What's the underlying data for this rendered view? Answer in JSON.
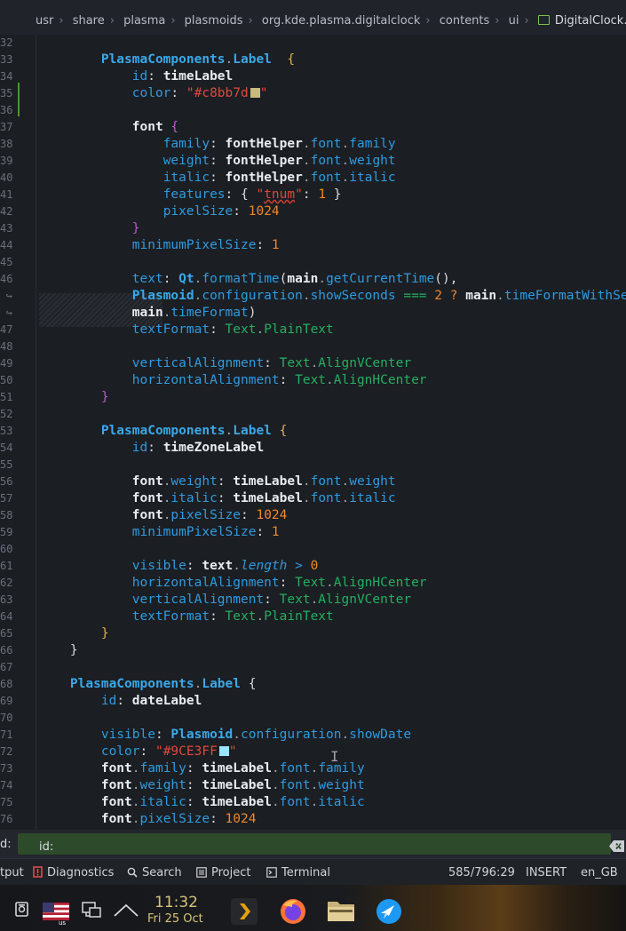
{
  "breadcrumb": {
    "segments": [
      "usr",
      "share",
      "plasma",
      "plasmoids",
      "org.kde.plasma.digitalclock",
      "contents",
      "ui"
    ],
    "file": "DigitalClock.qml"
  },
  "editor": {
    "line_numbers": [
      "32",
      "33",
      "34",
      "35",
      "36",
      "37",
      "38",
      "39",
      "40",
      "41",
      "42",
      "43",
      "44",
      "45",
      "46",
      "↪",
      "↪",
      "47",
      "48",
      "49",
      "50",
      "51",
      "52",
      "53",
      "54",
      "55",
      "56",
      "57",
      "58",
      "59",
      "60",
      "61",
      "62",
      "63",
      "64",
      "65",
      "66",
      "67",
      "68",
      "69",
      "70",
      "71",
      "72",
      "73",
      "74",
      "75",
      "76"
    ],
    "lines": [
      [],
      [
        [
          "s",
          "        "
        ],
        [
          "type",
          "PlasmaComponents"
        ],
        [
          "dot",
          "."
        ],
        [
          "type",
          "Label"
        ],
        [
          "s",
          "  "
        ],
        [
          "brace",
          "{"
        ]
      ],
      [
        [
          "s",
          "            "
        ],
        [
          "prop",
          "id"
        ],
        [
          "s",
          ": "
        ],
        [
          "id",
          "timeLabel"
        ]
      ],
      [
        [
          "s",
          "            "
        ],
        [
          "prop",
          "color"
        ],
        [
          "s",
          ": "
        ],
        [
          "str",
          "\"#c8bb7d"
        ],
        [
          "swatch",
          "#c8bb7d"
        ],
        [
          "str",
          "\""
        ]
      ],
      [],
      [
        [
          "s",
          "            "
        ],
        [
          "id",
          "font"
        ],
        [
          "s",
          " "
        ],
        [
          "brace2",
          "{"
        ]
      ],
      [
        [
          "s",
          "                "
        ],
        [
          "prop",
          "family"
        ],
        [
          "s",
          ": "
        ],
        [
          "id",
          "fontHelper"
        ],
        [
          "dot",
          "."
        ],
        [
          "prop",
          "font"
        ],
        [
          "dot",
          "."
        ],
        [
          "prop",
          "family"
        ]
      ],
      [
        [
          "s",
          "                "
        ],
        [
          "prop",
          "weight"
        ],
        [
          "s",
          ": "
        ],
        [
          "id",
          "fontHelper"
        ],
        [
          "dot",
          "."
        ],
        [
          "prop",
          "font"
        ],
        [
          "dot",
          "."
        ],
        [
          "prop",
          "weight"
        ]
      ],
      [
        [
          "s",
          "                "
        ],
        [
          "prop",
          "italic"
        ],
        [
          "s",
          ": "
        ],
        [
          "id",
          "fontHelper"
        ],
        [
          "dot",
          "."
        ],
        [
          "prop",
          "font"
        ],
        [
          "dot",
          "."
        ],
        [
          "prop",
          "italic"
        ]
      ],
      [
        [
          "s",
          "                "
        ],
        [
          "prop",
          "features"
        ],
        [
          "s",
          ": { "
        ],
        [
          "str",
          "\""
        ],
        [
          "strsq",
          "tnum"
        ],
        [
          "str",
          "\""
        ],
        [
          "s",
          ": "
        ],
        [
          "num",
          "1"
        ],
        [
          "s",
          " }"
        ]
      ],
      [
        [
          "s",
          "                "
        ],
        [
          "prop",
          "pixelSize"
        ],
        [
          "s",
          ": "
        ],
        [
          "num",
          "1024"
        ]
      ],
      [
        [
          "s",
          "            "
        ],
        [
          "brace2",
          "}"
        ]
      ],
      [
        [
          "s",
          "            "
        ],
        [
          "prop",
          "minimumPixelSize"
        ],
        [
          "s",
          ": "
        ],
        [
          "num",
          "1"
        ]
      ],
      [],
      [
        [
          "s",
          "            "
        ],
        [
          "prop",
          "text"
        ],
        [
          "s",
          ": "
        ],
        [
          "type",
          "Qt"
        ],
        [
          "dot",
          "."
        ],
        [
          "prop",
          "formatTime"
        ],
        [
          "s",
          "("
        ],
        [
          "id",
          "main"
        ],
        [
          "dot",
          "."
        ],
        [
          "prop",
          "getCurrentTime"
        ],
        [
          "s",
          "(),"
        ]
      ],
      [
        [
          "s",
          "            "
        ],
        [
          "type",
          "Plasmoid"
        ],
        [
          "dot",
          "."
        ],
        [
          "prop",
          "configuration"
        ],
        [
          "dot",
          "."
        ],
        [
          "prop",
          "showSeconds"
        ],
        [
          "s",
          " "
        ],
        [
          "enum",
          "==="
        ],
        [
          "s",
          " "
        ],
        [
          "num",
          "2"
        ],
        [
          "s",
          " "
        ],
        [
          "num",
          "?"
        ],
        [
          "s",
          " "
        ],
        [
          "id",
          "main"
        ],
        [
          "dot",
          "."
        ],
        [
          "prop",
          "timeFormatWithSeconds"
        ]
      ],
      [
        [
          "s",
          "            "
        ],
        [
          "id",
          "main"
        ],
        [
          "dot",
          "."
        ],
        [
          "prop",
          "timeFormat"
        ],
        [
          "s",
          ")"
        ]
      ],
      [
        [
          "s",
          "            "
        ],
        [
          "prop",
          "textFormat"
        ],
        [
          "s",
          ": "
        ],
        [
          "enum",
          "Text"
        ],
        [
          "dot",
          "."
        ],
        [
          "enum",
          "PlainText"
        ]
      ],
      [],
      [
        [
          "s",
          "            "
        ],
        [
          "prop",
          "verticalAlignment"
        ],
        [
          "s",
          ": "
        ],
        [
          "enum",
          "Text"
        ],
        [
          "dot",
          "."
        ],
        [
          "enum",
          "AlignVCenter"
        ]
      ],
      [
        [
          "s",
          "            "
        ],
        [
          "prop",
          "horizontalAlignment"
        ],
        [
          "s",
          ": "
        ],
        [
          "enum",
          "Text"
        ],
        [
          "dot",
          "."
        ],
        [
          "enum",
          "AlignHCenter"
        ]
      ],
      [
        [
          "s",
          "        "
        ],
        [
          "brace2",
          "}"
        ]
      ],
      [],
      [
        [
          "s",
          "        "
        ],
        [
          "type",
          "PlasmaComponents"
        ],
        [
          "dot",
          "."
        ],
        [
          "type",
          "Label"
        ],
        [
          "s",
          " "
        ],
        [
          "brace",
          "{"
        ]
      ],
      [
        [
          "s",
          "            "
        ],
        [
          "prop",
          "id"
        ],
        [
          "s",
          ": "
        ],
        [
          "id",
          "timeZoneLabel"
        ]
      ],
      [],
      [
        [
          "s",
          "            "
        ],
        [
          "id",
          "font"
        ],
        [
          "dot",
          "."
        ],
        [
          "prop",
          "weight"
        ],
        [
          "s",
          ": "
        ],
        [
          "id",
          "timeLabel"
        ],
        [
          "dot",
          "."
        ],
        [
          "prop",
          "font"
        ],
        [
          "dot",
          "."
        ],
        [
          "prop",
          "weight"
        ]
      ],
      [
        [
          "s",
          "            "
        ],
        [
          "id",
          "font"
        ],
        [
          "dot",
          "."
        ],
        [
          "prop",
          "italic"
        ],
        [
          "s",
          ": "
        ],
        [
          "id",
          "timeLabel"
        ],
        [
          "dot",
          "."
        ],
        [
          "prop",
          "font"
        ],
        [
          "dot",
          "."
        ],
        [
          "prop",
          "italic"
        ]
      ],
      [
        [
          "s",
          "            "
        ],
        [
          "id",
          "font"
        ],
        [
          "dot",
          "."
        ],
        [
          "prop",
          "pixelSize"
        ],
        [
          "s",
          ": "
        ],
        [
          "num",
          "1024"
        ]
      ],
      [
        [
          "s",
          "            "
        ],
        [
          "prop",
          "minimumPixelSize"
        ],
        [
          "s",
          ": "
        ],
        [
          "num",
          "1"
        ]
      ],
      [],
      [
        [
          "s",
          "            "
        ],
        [
          "prop",
          "visible"
        ],
        [
          "s",
          ": "
        ],
        [
          "id",
          "text"
        ],
        [
          "dot",
          "."
        ],
        [
          "ital",
          "length"
        ],
        [
          "s",
          " "
        ],
        [
          "prop",
          ">"
        ],
        [
          "s",
          " "
        ],
        [
          "num",
          "0"
        ]
      ],
      [
        [
          "s",
          "            "
        ],
        [
          "prop",
          "horizontalAlignment"
        ],
        [
          "s",
          ": "
        ],
        [
          "enum",
          "Text"
        ],
        [
          "dot",
          "."
        ],
        [
          "enum",
          "AlignHCenter"
        ]
      ],
      [
        [
          "s",
          "            "
        ],
        [
          "prop",
          "verticalAlignment"
        ],
        [
          "s",
          ": "
        ],
        [
          "enum",
          "Text"
        ],
        [
          "dot",
          "."
        ],
        [
          "enum",
          "AlignVCenter"
        ]
      ],
      [
        [
          "s",
          "            "
        ],
        [
          "prop",
          "textFormat"
        ],
        [
          "s",
          ": "
        ],
        [
          "enum",
          "Text"
        ],
        [
          "dot",
          "."
        ],
        [
          "enum",
          "PlainText"
        ]
      ],
      [
        [
          "s",
          "        "
        ],
        [
          "brace",
          "}"
        ]
      ],
      [
        [
          "s",
          "    }"
        ]
      ],
      [],
      [
        [
          "s",
          "    "
        ],
        [
          "type",
          "PlasmaComponents"
        ],
        [
          "dot",
          "."
        ],
        [
          "type",
          "Label"
        ],
        [
          "s",
          " {"
        ]
      ],
      [
        [
          "s",
          "        "
        ],
        [
          "prop",
          "id"
        ],
        [
          "s",
          ": "
        ],
        [
          "id",
          "dateLabel"
        ]
      ],
      [],
      [
        [
          "s",
          "        "
        ],
        [
          "prop",
          "visible"
        ],
        [
          "s",
          ": "
        ],
        [
          "type",
          "Plasmoid"
        ],
        [
          "dot",
          "."
        ],
        [
          "prop",
          "configuration"
        ],
        [
          "dot",
          "."
        ],
        [
          "prop",
          "showDate"
        ]
      ],
      [
        [
          "s",
          "        "
        ],
        [
          "prop",
          "color"
        ],
        [
          "s",
          ": "
        ],
        [
          "str",
          "\"#9CE3FF"
        ],
        [
          "swatch",
          "#9CE3FF"
        ],
        [
          "str",
          "\""
        ]
      ],
      [
        [
          "s",
          "        "
        ],
        [
          "id",
          "font"
        ],
        [
          "dot",
          "."
        ],
        [
          "prop",
          "family"
        ],
        [
          "s",
          ": "
        ],
        [
          "id",
          "timeLabel"
        ],
        [
          "dot",
          "."
        ],
        [
          "prop",
          "font"
        ],
        [
          "dot",
          "."
        ],
        [
          "prop",
          "family"
        ]
      ],
      [
        [
          "s",
          "        "
        ],
        [
          "id",
          "font"
        ],
        [
          "dot",
          "."
        ],
        [
          "prop",
          "weight"
        ],
        [
          "s",
          ": "
        ],
        [
          "id",
          "timeLabel"
        ],
        [
          "dot",
          "."
        ],
        [
          "prop",
          "font"
        ],
        [
          "dot",
          "."
        ],
        [
          "prop",
          "weight"
        ]
      ],
      [
        [
          "s",
          "        "
        ],
        [
          "id",
          "font"
        ],
        [
          "dot",
          "."
        ],
        [
          "prop",
          "italic"
        ],
        [
          "s",
          ": "
        ],
        [
          "id",
          "timeLabel"
        ],
        [
          "dot",
          "."
        ],
        [
          "prop",
          "font"
        ],
        [
          "dot",
          "."
        ],
        [
          "prop",
          "italic"
        ]
      ],
      [
        [
          "s",
          "        "
        ],
        [
          "id",
          "font"
        ],
        [
          "dot",
          "."
        ],
        [
          "prop",
          "pixelSize"
        ],
        [
          "s",
          ": "
        ],
        [
          "num",
          "1024"
        ]
      ]
    ]
  },
  "findbar": {
    "label": "d:",
    "placeholder": "",
    "value": "id:"
  },
  "statusbar": {
    "output": "tput",
    "diagnostics": "Diagnostics",
    "search": "Search",
    "project": "Project",
    "terminal": "Terminal",
    "position": "585/796:29",
    "mode": "INSERT",
    "language": "en_GB"
  },
  "taskbar": {
    "clock_time": "11:32",
    "clock_date": "Fri 25 Oct",
    "keyboard_layout": "us"
  },
  "colors": {
    "accent_green": "#4c9a2e",
    "clock": "#d7c27a",
    "timeLabel_color": "#c8bb7d",
    "dateLabel_color": "#9CE3FF"
  }
}
